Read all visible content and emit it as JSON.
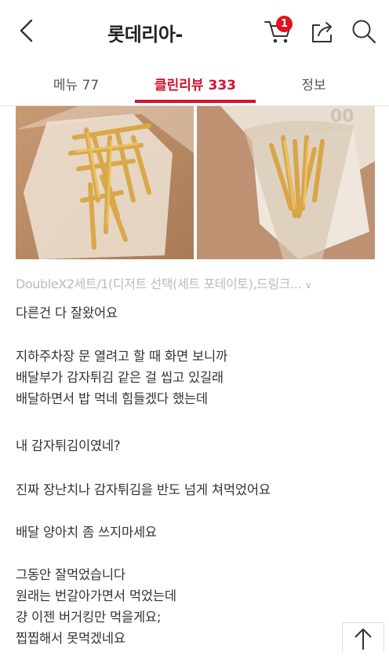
{
  "header": {
    "title": "롯데리아-",
    "cart_count": "1",
    "icons": {
      "back": "chevron-left-icon",
      "cart": "cart-icon",
      "share": "share-icon",
      "search": "search-icon"
    },
    "accent_color": "#d5112c"
  },
  "tabs": [
    {
      "label": "메뉴 77",
      "active": false
    },
    {
      "label": "클린리뷰 333",
      "active": true
    },
    {
      "label": "정보",
      "active": false
    }
  ],
  "review": {
    "order_summary": "DoubleX2세트/1(디저트 선택(세트 포테이토),드링크...",
    "lines": [
      "다른건 다 잘왔어요",
      "",
      "지하주차장 문 열려고 할 때 화면 보니까",
      "배달부가 감자튀김 같은 걸 씹고 있길래",
      "배달하면서 밥 먹네 힘들겠다 했는데",
      "",
      "내 감자튀김이였네?",
      "",
      "진짜 장난치나 감자튀김을 반도 넘게 쳐먹었어요",
      "",
      "배달 양아치 좀 쓰지마세요",
      "",
      "그동안 잘먹었습니다",
      "원래는 번갈아가면서 먹었는데",
      "걍 이젠 버거킹만 먹을게요;",
      "찝찝해서 못먹겠네요"
    ]
  },
  "scroll_top_icon": "arrow-up-icon"
}
